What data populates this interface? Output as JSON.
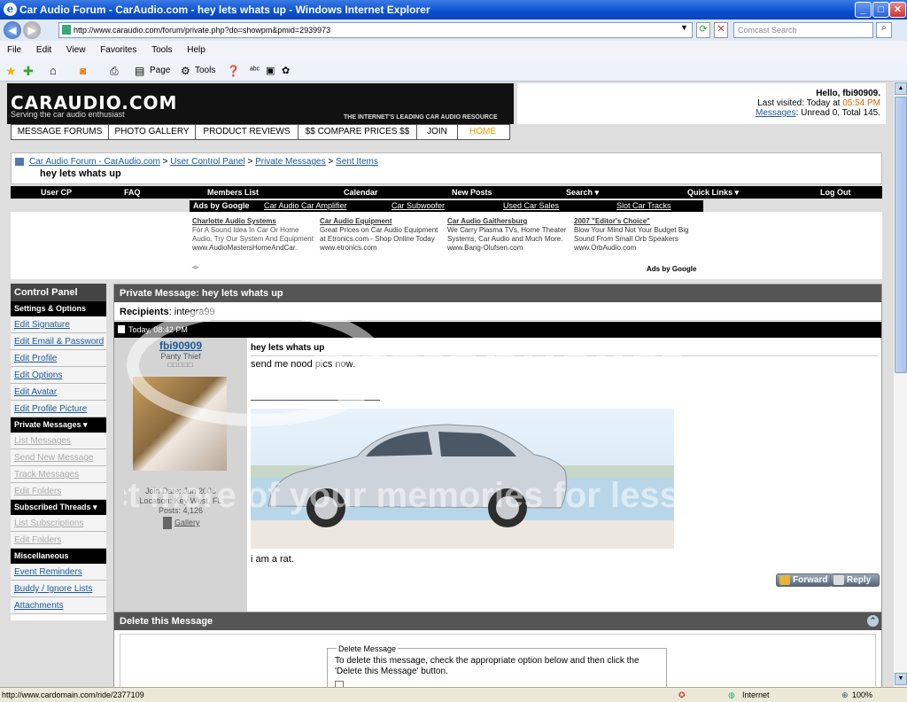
{
  "window": {
    "title": "Car Audio Forum - CarAudio.com - hey lets whats up - Windows Internet Explorer",
    "url": "http://www.caraudio.com/forum/private.php?do=showpm&pmid=2939973",
    "search_placeholder": "Comcast Search"
  },
  "menu": [
    "File",
    "Edit",
    "View",
    "Favorites",
    "Tools",
    "Help"
  ],
  "toolbar": {
    "page": "Page",
    "tools": "Tools"
  },
  "header": {
    "logo": "CARAUDIO.COM",
    "tagline": "Serving the car audio enthusiast",
    "slogan": "THE INTERNET'S LEADING CAR AUDIO RESOURCE",
    "greeting": "Hello, fbi90909.",
    "last_visited_label": "Last visited: Today at",
    "last_visited_time": "05:54 PM",
    "messages_link": "Messages",
    "messages_status": ": Unread 0, Total 145."
  },
  "topnav": [
    "MESSAGE FORUMS",
    "PHOTO GALLERY",
    "PRODUCT REVIEWS",
    "$$  COMPARE PRICES  $$",
    "JOIN",
    "HOME"
  ],
  "breadcrumb": {
    "items": [
      "Car Audio Forum - CarAudio.com",
      "User Control Panel",
      "Private Messages",
      "Sent Items"
    ],
    "title": "hey lets whats up"
  },
  "navstrip": [
    "User CP",
    "FAQ",
    "Members List",
    "Calendar",
    "New Posts",
    "Search ▾",
    "Quick Links ▾",
    "Log Out"
  ],
  "adtabs": [
    "Ads by Google",
    "Car Audio Car Amplifier",
    "Car Subwoofer",
    "Used Car Sales",
    "Slot Car Tracks"
  ],
  "ads": [
    {
      "title": "Charlotte Audio Systems",
      "body": "For A Sound Idea In Car Or Home Audio, Try Our System And Equipment",
      "url": "www.AudioMastersHomeAndCar."
    },
    {
      "title": "Car Audio Equipment",
      "body": "Great Prices on Car Audio Equipment at Etronics.com - Shop Online Today",
      "url": "www.etronics.com"
    },
    {
      "title": "Car Audio Gaithersburg",
      "body": "We Carry Plasma TVs, Home Theater Systems, Car Audio and Much More.",
      "url": "www.Bang-Olufsen.com"
    },
    {
      "title": "2007 \"Editor's Choice\"",
      "body": "Blow Your Mind Not Your Budget Big Sound From Small Orb Speakers",
      "url": "www.OrbAudio.com"
    }
  ],
  "ads_by_google": "Ads by Google",
  "sidebar": {
    "title": "Control Panel",
    "sections": [
      {
        "label": "Settings & Options",
        "items": [
          "Edit Signature",
          "Edit Email & Password",
          "Edit Profile",
          "Edit Options",
          "Edit Avatar",
          "Edit Profile Picture"
        ]
      },
      {
        "label": "Private Messages ▾",
        "items": [
          "List Messages",
          "Send New Message",
          "Track Messages",
          "Edit Folders"
        ]
      },
      {
        "label": "Subscribed Threads ▾",
        "items": [
          "List Subscriptions",
          "Edit Folders"
        ]
      },
      {
        "label": "Miscellaneous",
        "items": [
          "Event Reminders",
          "Buddy / Ignore Lists",
          "Attachments"
        ]
      }
    ]
  },
  "pm": {
    "header": "Private Message: hey lets whats up",
    "recipients_label": "Recipients",
    "recipients": "integra99",
    "date": "Today, 08:42 PM",
    "username": "fbi90909",
    "user_title": "Panty Thief",
    "join_date": "Join Date: Jun 2006",
    "location": "Location: Key West, FL",
    "posts": "Posts: 4,126",
    "gallery": "Gallery",
    "subject": "hey lets whats up",
    "body": "send me nood pics now.",
    "signature": "i am a rat.",
    "forward": "Forward",
    "reply": "Reply"
  },
  "delete": {
    "header": "Delete this Message",
    "legend": "Delete Message",
    "text": "To delete this message, check the appropriate option below and then click the 'Delete this Message' button."
  },
  "watermark": {
    "top": "photobucket",
    "bottom": "Protect more of your memories for less!"
  },
  "status": {
    "url": "http://www.cardomain.com/ride/2377109",
    "zone": "Internet",
    "zoom": "100%"
  }
}
